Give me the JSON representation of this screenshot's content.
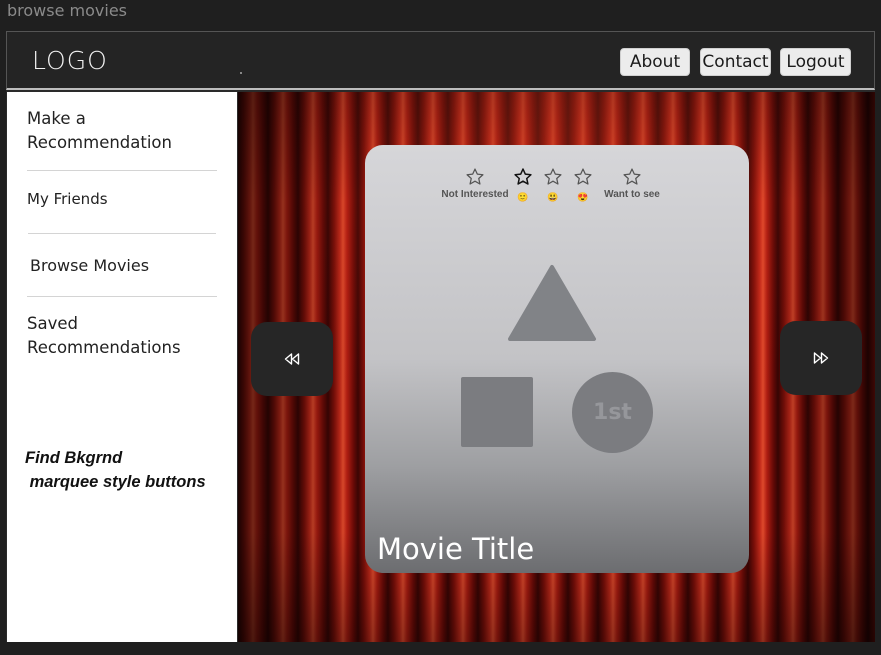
{
  "window": {
    "title": "browse movies"
  },
  "header": {
    "logo": "LOGO",
    "nav": [
      {
        "label": "About"
      },
      {
        "label": "Contact"
      },
      {
        "label": "Logout"
      }
    ]
  },
  "sidebar": {
    "items": [
      {
        "label": "Make a\nRecommendation"
      },
      {
        "label": "My Friends"
      },
      {
        "label": "Browse Movies"
      },
      {
        "label": "Saved\nRecommendations"
      }
    ],
    "note": "Find Bkgrnd\n marquee style buttons"
  },
  "carousel": {
    "prev_icon": "rewind-icon",
    "next_icon": "fast-forward-icon"
  },
  "card": {
    "ratings": [
      {
        "label": "Not Interested",
        "icon": "star-icon"
      },
      {
        "emoji": "🙂",
        "icon": "star-icon"
      },
      {
        "emoji": "😃",
        "icon": "star-icon"
      },
      {
        "emoji": "😍",
        "icon": "star-icon"
      },
      {
        "label": "Want to see",
        "icon": "star-icon"
      }
    ],
    "placeholder_badge": "1st",
    "movie_title": "Movie Title"
  },
  "colors": {
    "topbar": "#242424",
    "sidebar": "#ffffff",
    "arrow_button": "#262626",
    "curtain": "#b31e12"
  }
}
